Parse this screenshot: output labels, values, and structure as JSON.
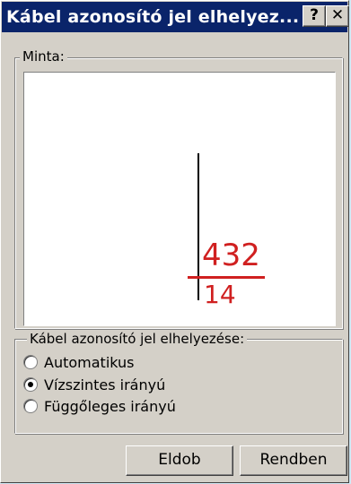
{
  "window": {
    "title": "Kábel azonosító jel elhelyez...",
    "help_label": "?",
    "close_label": "✕"
  },
  "preview": {
    "group_label": "Minta:",
    "id_top": "432",
    "id_bottom": "14",
    "id_color": "#d02020"
  },
  "placement": {
    "group_label": "Kábel azonosító jel elhelyezése:",
    "options": [
      {
        "label": "Automatikus",
        "selected": false
      },
      {
        "label": "Vízszintes irányú",
        "selected": true
      },
      {
        "label": "Függőleges irányú",
        "selected": false
      }
    ]
  },
  "buttons": {
    "discard_label": "Eldob",
    "ok_label": "Rendben"
  }
}
